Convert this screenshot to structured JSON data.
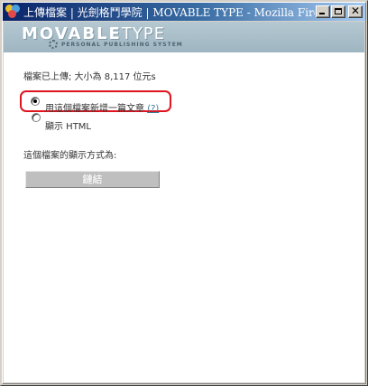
{
  "window": {
    "title": "上傳檔案 | 光劍格鬥學院 | MOVABLE TYPE - Mozilla Firebird",
    "minimize_icon": "minimize-icon",
    "maximize_icon": "maximize-icon",
    "close_glyph": "✕"
  },
  "header": {
    "logo_movable": "MOVABLE",
    "logo_type": "TYPE",
    "logo_sub": "PERSONAL PUBLISHING SYSTEM"
  },
  "main": {
    "status": "檔案已上傳; 大小為 8,117 位元s",
    "option_new_entry": "用這個檔案新增一篇文章",
    "option_new_entry_help": "(?)",
    "option_show_html": "顯示 HTML",
    "display_label": "這個檔案的顯示方式為:",
    "link_button": "鏈結"
  },
  "colors": {
    "highlight_box": "#e0141e",
    "banner": "#9eb5c1"
  }
}
